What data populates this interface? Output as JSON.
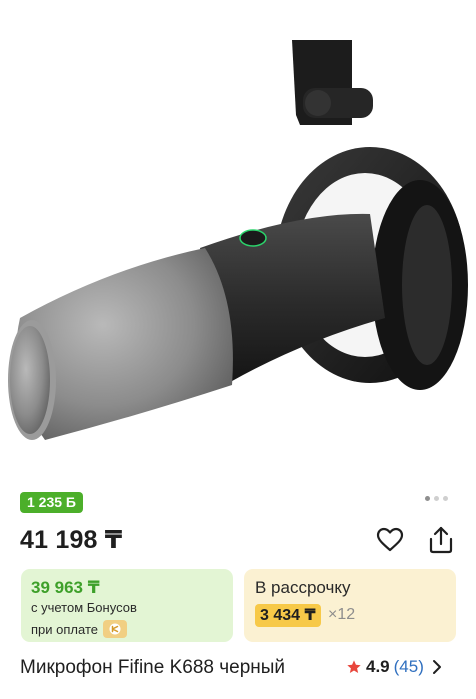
{
  "product": {
    "image_alt": "Микрофон Fifine K688",
    "bonus_badge": "1 235 Б",
    "price": "41 198 ₸",
    "bonus_card": {
      "price": "39 963 ₸",
      "line1": "с учетом Бонусов",
      "line2": "при оплате"
    },
    "installment_card": {
      "title": "В рассрочку",
      "amount": "3 434 ₸",
      "times": "×12"
    },
    "title": "Микрофон Fifine K688 черный",
    "rating": {
      "value": "4.9",
      "count": "(45)"
    }
  },
  "gallery": {
    "total": 3,
    "active": 0
  },
  "colors": {
    "bonus_green": "#4caf2a",
    "bonus_card_bg": "#e3f5d4",
    "installment_bg": "#fbf1d2",
    "installment_badge": "#f7c948",
    "rating_star": "#e8463c",
    "link_blue": "#2f6fbf"
  },
  "icons": [
    "heart-icon",
    "share-icon",
    "star-icon",
    "chevron-right-icon",
    "payment-icon"
  ]
}
